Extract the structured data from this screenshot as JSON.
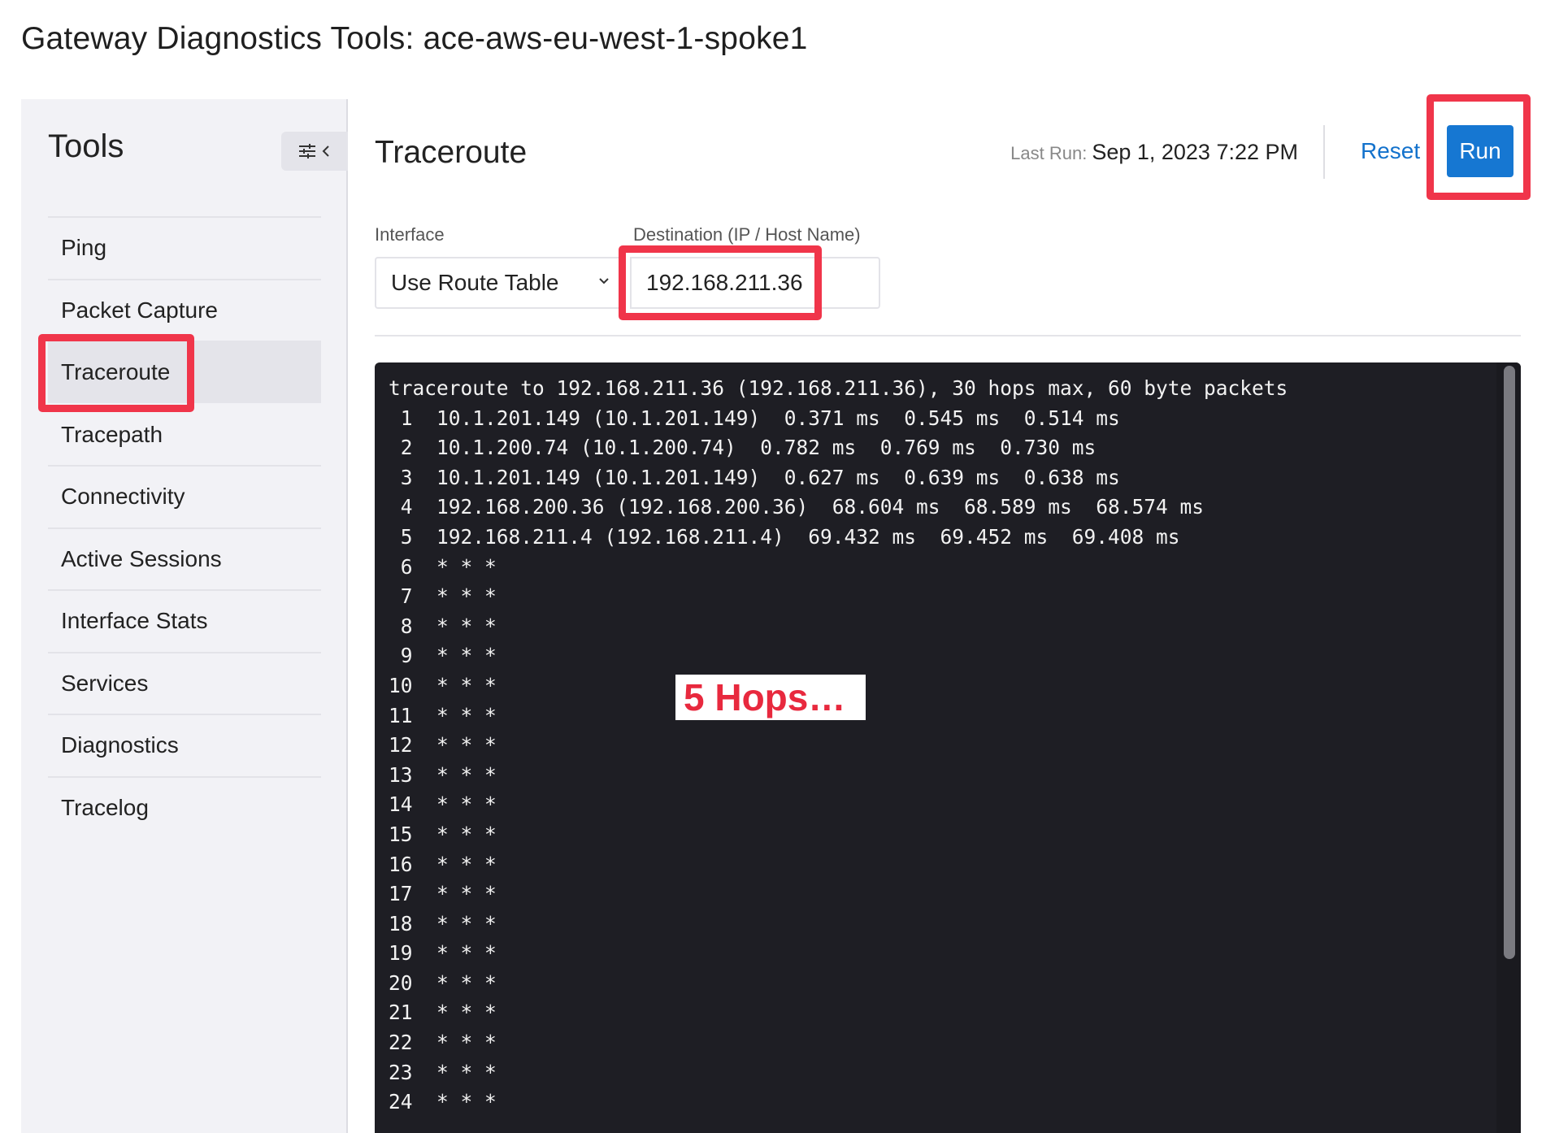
{
  "page": {
    "title": "Gateway Diagnostics Tools: ace-aws-eu-west-1-spoke1"
  },
  "sidebar": {
    "title": "Tools",
    "collapse_icons": "settings-sliders-icon, chevron-left-icon",
    "items": [
      {
        "label": "Ping"
      },
      {
        "label": "Packet Capture"
      },
      {
        "label": "Traceroute",
        "active": true
      },
      {
        "label": "Tracepath"
      },
      {
        "label": "Connectivity"
      },
      {
        "label": "Active Sessions"
      },
      {
        "label": "Interface Stats"
      },
      {
        "label": "Services"
      },
      {
        "label": "Diagnostics"
      },
      {
        "label": "Tracelog"
      }
    ]
  },
  "main": {
    "title": "Traceroute",
    "last_run_label": "Last Run:",
    "last_run_value": "Sep 1, 2023 7:22 PM",
    "reset_label": "Reset",
    "run_label": "Run",
    "interface": {
      "label": "Interface",
      "value": "Use Route Table"
    },
    "destination": {
      "label": "Destination (IP / Host Name)",
      "value": "192.168.211.36"
    },
    "output_lines": [
      "traceroute to 192.168.211.36 (192.168.211.36), 30 hops max, 60 byte packets",
      " 1  10.1.201.149 (10.1.201.149)  0.371 ms  0.545 ms  0.514 ms",
      " 2  10.1.200.74 (10.1.200.74)  0.782 ms  0.769 ms  0.730 ms",
      " 3  10.1.201.149 (10.1.201.149)  0.627 ms  0.639 ms  0.638 ms",
      " 4  192.168.200.36 (192.168.200.36)  68.604 ms  68.589 ms  68.574 ms",
      " 5  192.168.211.4 (192.168.211.4)  69.432 ms  69.452 ms  69.408 ms",
      " 6  * * *",
      " 7  * * *",
      " 8  * * *",
      " 9  * * *",
      "10  * * *",
      "11  * * *",
      "12  * * *",
      "13  * * *",
      "14  * * *",
      "15  * * *",
      "16  * * *",
      "17  * * *",
      "18  * * *",
      "19  * * *",
      "20  * * *",
      "21  * * *",
      "22  * * *",
      "23  * * *",
      "24  * * *"
    ]
  },
  "annotation": {
    "callout_text": "5 Hops…",
    "highlight_color": "#f0354a"
  },
  "colors": {
    "accent": "#1677d2",
    "terminal_bg": "#1e1e24",
    "sidebar_bg": "#f2f2f6"
  }
}
